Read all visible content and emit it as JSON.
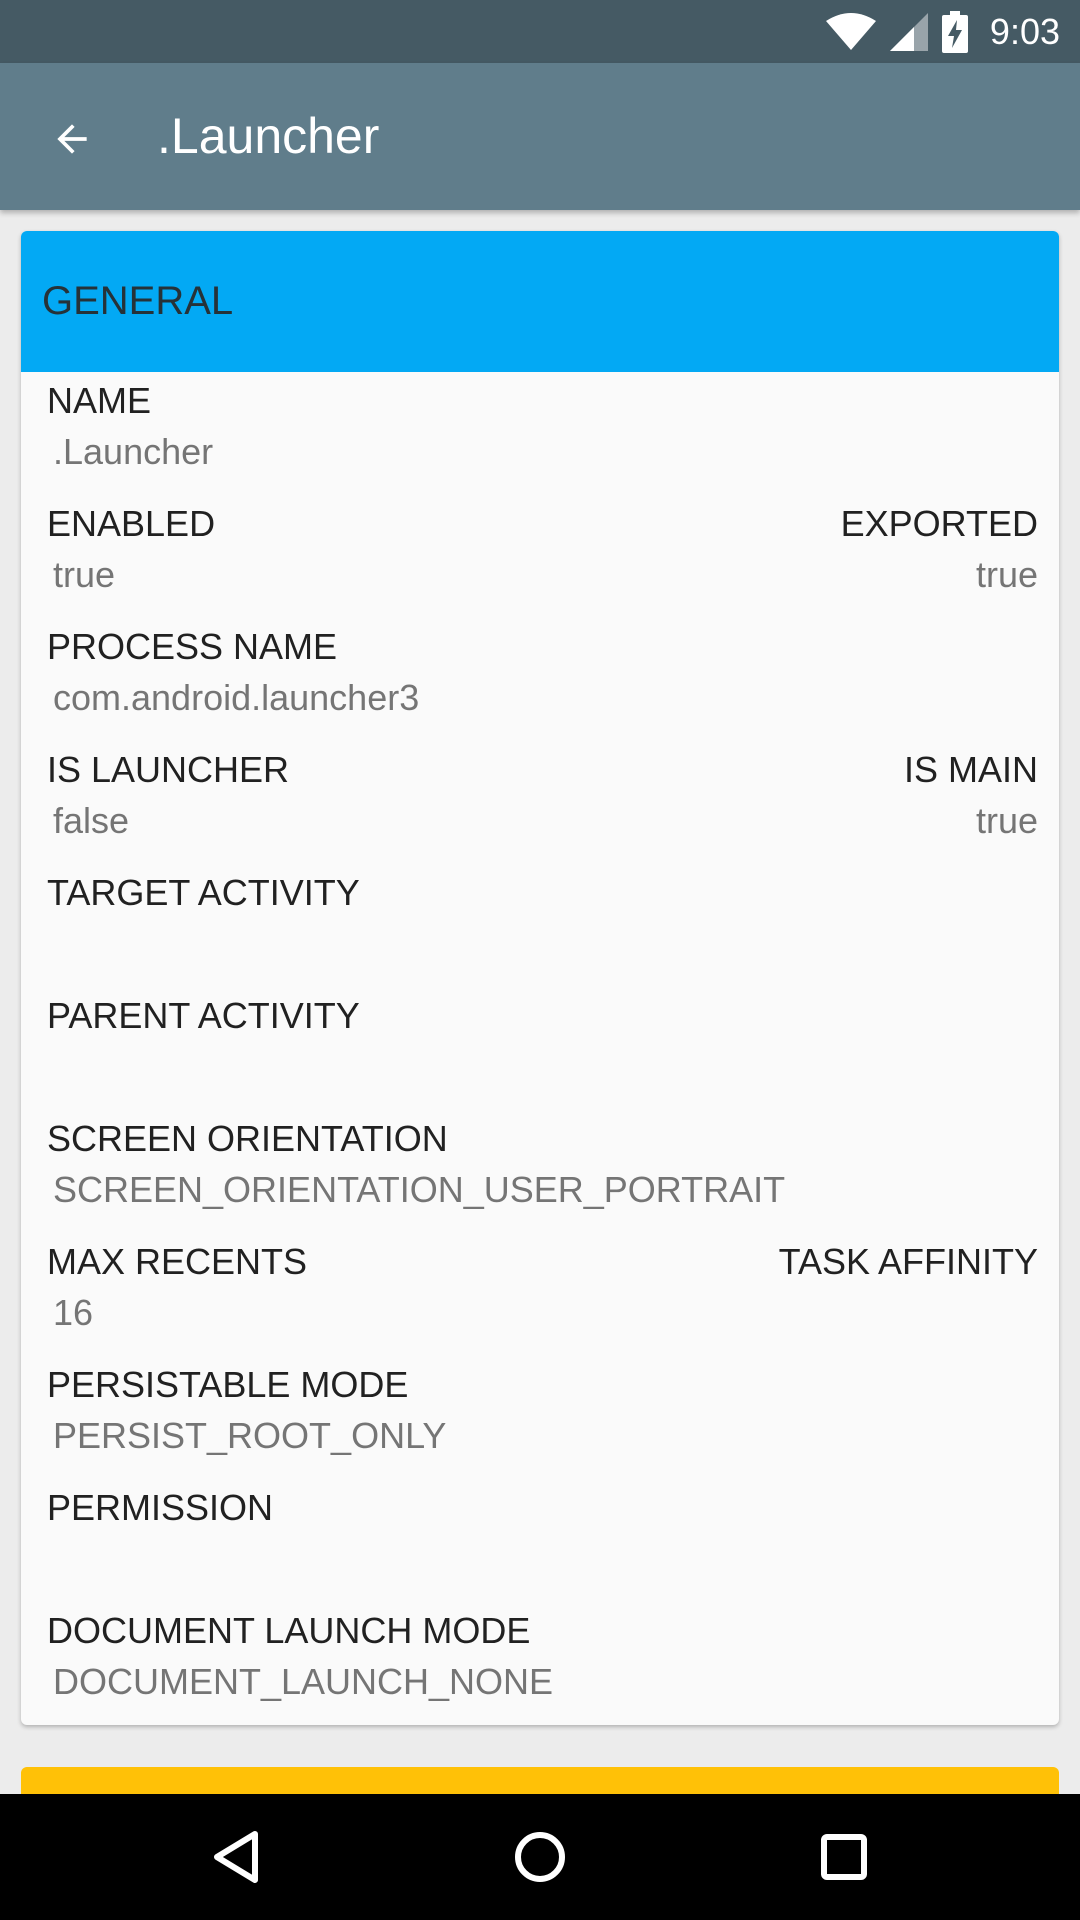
{
  "status_bar": {
    "time": "9:03",
    "icons": [
      "wifi-icon",
      "signal-icon",
      "battery-charging-icon"
    ]
  },
  "app_bar": {
    "back_icon": "arrow-back-icon",
    "title": ".Launcher"
  },
  "section": {
    "title": "GENERAL",
    "color": "#03a9f4"
  },
  "fields": {
    "name": {
      "label": "NAME",
      "value": ".Launcher"
    },
    "enabled": {
      "label": "ENABLED",
      "value": "true"
    },
    "exported": {
      "label": "EXPORTED",
      "value": "true"
    },
    "process_name": {
      "label": "PROCESS NAME",
      "value": "com.android.launcher3"
    },
    "is_launcher": {
      "label": "IS LAUNCHER",
      "value": "false"
    },
    "is_main": {
      "label": "IS MAIN",
      "value": "true"
    },
    "target_activity": {
      "label": "TARGET ACTIVITY",
      "value": ""
    },
    "parent_activity": {
      "label": "PARENT ACTIVITY",
      "value": ""
    },
    "screen_orientation": {
      "label": "SCREEN ORIENTATION",
      "value": "SCREEN_ORIENTATION_USER_PORTRAIT"
    },
    "max_recents": {
      "label": "MAX RECENTS",
      "value": "16"
    },
    "task_affinity": {
      "label": "TASK AFFINITY",
      "value": ""
    },
    "persistable_mode": {
      "label": "PERSISTABLE MODE",
      "value": "PERSIST_ROOT_ONLY"
    },
    "permission": {
      "label": "PERMISSION",
      "value": ""
    },
    "document_launch_mode": {
      "label": "DOCUMENT LAUNCH MODE",
      "value": "DOCUMENT_LAUNCH_NONE"
    }
  },
  "next_section_color": "#ffc107",
  "nav_bar": {
    "buttons": [
      "back-triangle-icon",
      "home-circle-icon",
      "recents-square-icon"
    ]
  }
}
